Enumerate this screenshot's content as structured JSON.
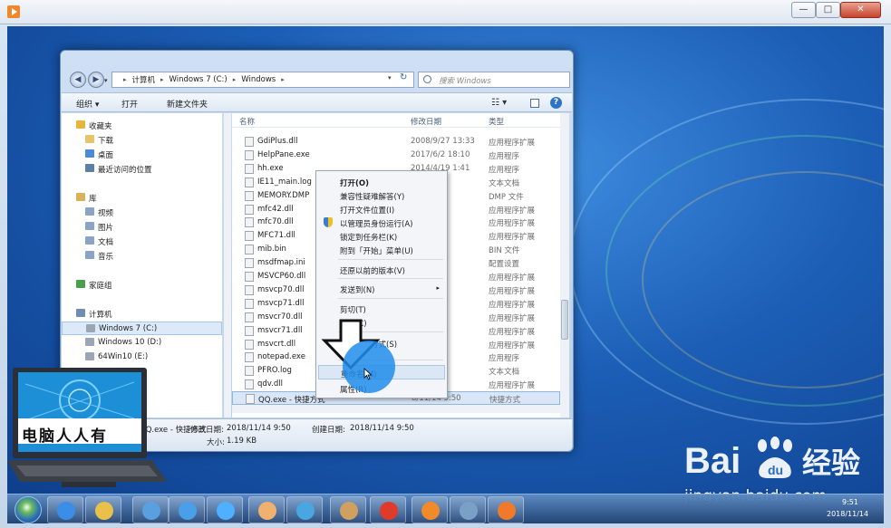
{
  "host_window": {
    "minimize": "—",
    "maximize": "□",
    "close": "✕"
  },
  "explorer": {
    "nav": {
      "back": "◀",
      "forward": "▶",
      "history": "▾"
    },
    "breadcrumb": [
      "计算机",
      "Windows 7 (C:)",
      "Windows"
    ],
    "breadcrumb_sep": "▸",
    "address_dropdown": "▾",
    "refresh": "↻",
    "search_placeholder": "搜索 Windows",
    "toolbar": {
      "organize": "组织 ▾",
      "open": "打开",
      "new_folder": "新建文件夹",
      "view": "☷ ▾",
      "help": "?"
    },
    "nav_pane": [
      {
        "label": "收藏夹",
        "indent": 0,
        "color": "#e8b53a"
      },
      {
        "label": "下载",
        "indent": 1,
        "color": "#e7c46c"
      },
      {
        "label": "桌面",
        "indent": 1,
        "color": "#4d8ad6"
      },
      {
        "label": "最近访问的位置",
        "indent": 1,
        "color": "#5c7fa5"
      },
      {
        "label": "库",
        "indent": 0,
        "color": "#d9b25a"
      },
      {
        "label": "视频",
        "indent": 1,
        "color": "#8aa4c4"
      },
      {
        "label": "图片",
        "indent": 1,
        "color": "#8aa4c4"
      },
      {
        "label": "文档",
        "indent": 1,
        "color": "#8aa4c4"
      },
      {
        "label": "音乐",
        "indent": 1,
        "color": "#8aa4c4"
      },
      {
        "label": "家庭组",
        "indent": 0,
        "color": "#4aa04a"
      },
      {
        "label": "计算机",
        "indent": 0,
        "color": "#6f8db2"
      },
      {
        "label": "Windows 7 (C:)",
        "indent": 1,
        "color": "#9aa6b5",
        "selected": true
      },
      {
        "label": "Windows 10 (D:)",
        "indent": 1,
        "color": "#9aa6b5"
      },
      {
        "label": "64Win10 (E:)",
        "indent": 1,
        "color": "#9aa6b5"
      }
    ],
    "columns": {
      "name": "名称",
      "date": "修改日期",
      "type": "类型"
    },
    "files": [
      {
        "name": "GdiPlus.dll",
        "date": "2008/9/27 13:33",
        "type": "应用程序扩展"
      },
      {
        "name": "HelpPane.exe",
        "date": "2017/6/2 18:10",
        "type": "应用程序"
      },
      {
        "name": "hh.exe",
        "date": "2014/4/19 1:41",
        "type": "应用程序"
      },
      {
        "name": "IE11_main.log",
        "date": "8 13:22",
        "type": "文本文档"
      },
      {
        "name": "MEMORY.DMP",
        "date": "3 20:23",
        "type": "DMP 文件"
      },
      {
        "name": "mfc42.dll",
        "date": "6:41",
        "type": "应用程序扩展"
      },
      {
        "name": "mfc70.dll",
        "date": "6:48",
        "type": "应用程序扩展"
      },
      {
        "name": "MFC71.dll",
        "date": "6:48",
        "type": "应用程序扩展"
      },
      {
        "name": "mib.bin",
        "date": "9:06",
        "type": "BIN 文件"
      },
      {
        "name": "msdfmap.ini",
        "date": "6:36",
        "type": "配置设置"
      },
      {
        "name": "MSVCP60.dll",
        "date": "5:29",
        "type": "应用程序扩展"
      },
      {
        "name": "msvcp70.dll",
        "date": "5:40",
        "type": "应用程序扩展"
      },
      {
        "name": "msvcp71.dll",
        "date": "14:43",
        "type": "应用程序扩展"
      },
      {
        "name": "msvcr70.dll",
        "date": "2:37",
        "type": "应用程序扩展"
      },
      {
        "name": "msvcr71.dll",
        "date": "2:28",
        "type": "应用程序扩展"
      },
      {
        "name": "msvcrt.dll",
        "date": "",
        "type": "应用程序扩展"
      },
      {
        "name": "notepad.exe",
        "date": "",
        "type": "应用程序"
      },
      {
        "name": "PFRO.log",
        "date": "17:11",
        "type": "文本文档"
      },
      {
        "name": "qdv.dll",
        "date": "",
        "type": "应用程序扩展"
      },
      {
        "name": "QQ.exe - 快捷方式",
        "date": "8/11/14 9:50",
        "type": "快捷方式"
      }
    ],
    "details": {
      "name": "QQ.exe - 快捷方式",
      "modified_label": "修改日期:",
      "modified": "2018/11/14 9:50",
      "created_label": "创建日期:",
      "created": "2018/11/14 9:50",
      "size_label": "大小:",
      "size": "1.19 KB"
    }
  },
  "context_menu": {
    "items": [
      {
        "label": "打开(O)",
        "bold": true
      },
      {
        "label": "兼容性疑难解答(Y)"
      },
      {
        "label": "打开文件位置(I)"
      },
      {
        "label": "以管理员身份运行(A)",
        "icon": "shield-icon"
      },
      {
        "label": "锁定到任务栏(K)"
      },
      {
        "label": "附到「开始」菜单(U)"
      },
      {
        "label": "还原以前的版本(V)"
      },
      {
        "label": "发送到(N)",
        "submenu": "▸"
      },
      {
        "label": "剪切(T)"
      },
      {
        "label": "复制(C)"
      },
      {
        "label": "创建快捷方式(S)"
      },
      {
        "label": "重命名(M)",
        "highlight": true
      },
      {
        "label": "属性(R)"
      }
    ]
  },
  "overlay": {
    "laptop_caption": "电脑人人有",
    "baidu_brand": "Bai 经验",
    "baidu_url": "jingyan.baidu.com"
  },
  "taskbar": {
    "apps": [
      "ie-icon",
      "folder-icon",
      "explorer-icon",
      "qq-app-icon",
      "browser-icon",
      "paint-icon",
      "pinwheel-icon",
      "tools-icon",
      "chess-icon",
      "media-icon",
      "network-icon",
      "firefox-icon"
    ],
    "time": "9:51",
    "date": "2018/11/14"
  },
  "colors": {
    "accent": "#2a78d6",
    "selection": "#d8e6f7",
    "desktop": "#1c5eb6"
  }
}
